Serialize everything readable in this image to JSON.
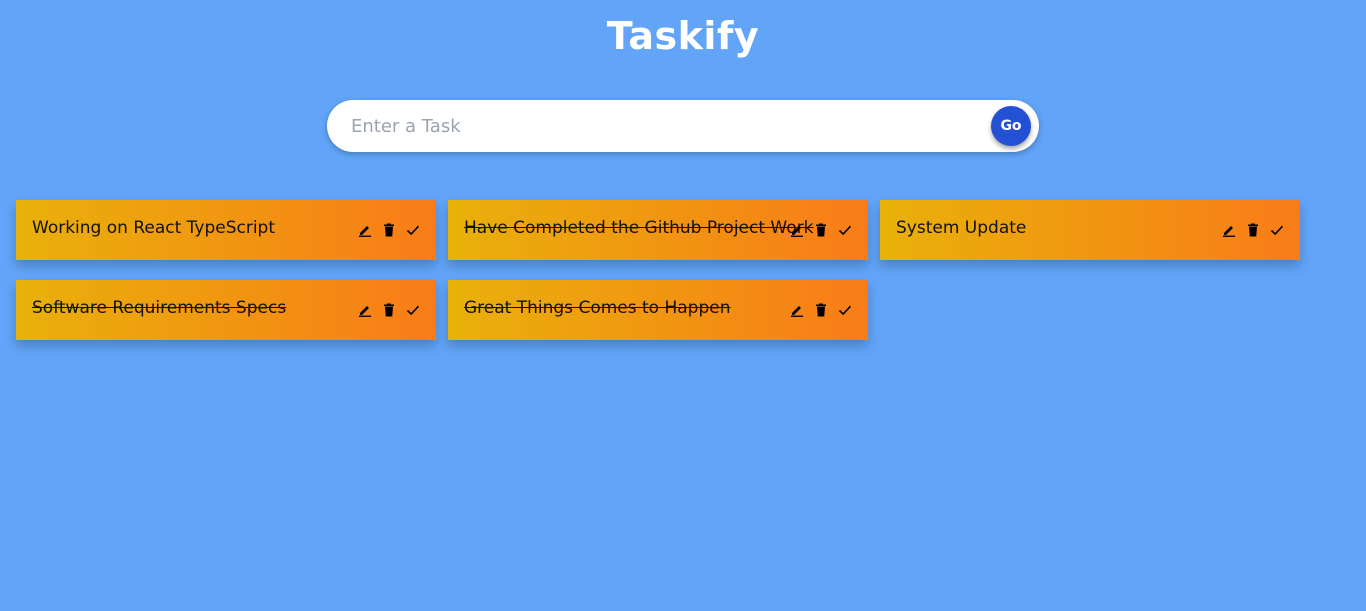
{
  "header": {
    "title": "Taskify"
  },
  "search": {
    "placeholder": "Enter a Task",
    "value": "",
    "button_label": "Go"
  },
  "todos": [
    {
      "text": "Working on React TypeScript",
      "done": false
    },
    {
      "text": "Have Completed the Github Project Work",
      "done": true
    },
    {
      "text": "System Update",
      "done": false
    },
    {
      "text": "Software Requirements Specs",
      "done": true
    },
    {
      "text": "Great Things Comes to Happen",
      "done": true
    }
  ],
  "icons": {
    "edit": "edit-icon",
    "delete": "delete-icon",
    "done": "check-icon"
  },
  "colors": {
    "background": "#61a4f8",
    "go_button": "#2450d6",
    "card_gradient_start": "#e9b10a",
    "card_gradient_end": "#f97b18"
  }
}
